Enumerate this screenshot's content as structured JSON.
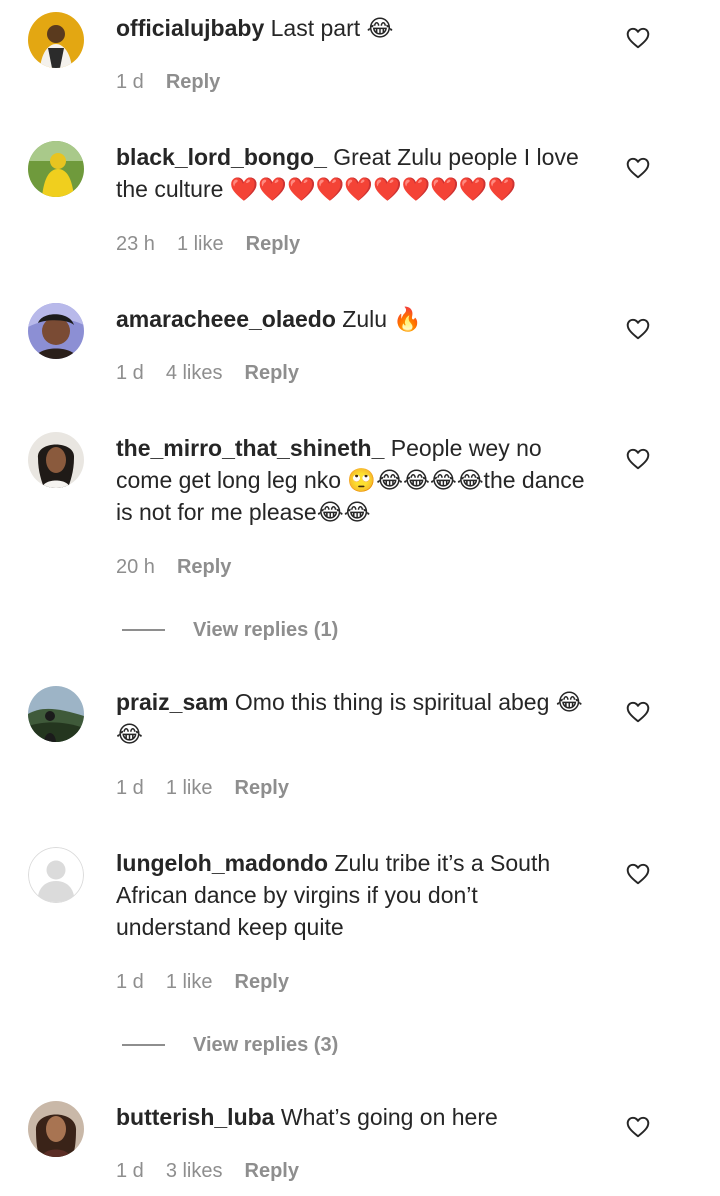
{
  "comments": [
    {
      "username": "officialujbaby",
      "text": "Last part 😂",
      "time": "1 d",
      "likes": "",
      "reply": "Reply"
    },
    {
      "username": "black_lord_bongo_",
      "text": "Great Zulu people I love the culture ❤️❤️❤️❤️❤️❤️❤️❤️❤️❤️",
      "time": "23 h",
      "likes": "1 like",
      "reply": "Reply"
    },
    {
      "username": "amaracheee_olaedo",
      "text": "Zulu 🔥",
      "time": "1 d",
      "likes": "4 likes",
      "reply": "Reply"
    },
    {
      "username": "the_mirro_that_shineth_",
      "text": "People wey no come get long leg nko 🙄😂😂😂😂the dance is not for me please😂😂",
      "time": "20 h",
      "likes": "",
      "reply": "Reply",
      "view_replies": "View replies (1)"
    },
    {
      "username": "praiz_sam",
      "text": "Omo this thing is spiritual abeg 😂😂",
      "time": "1 d",
      "likes": "1 like",
      "reply": "Reply"
    },
    {
      "username": "lungeloh_madondo",
      "text": "Zulu tribe it’s a South African dance by virgins if you don’t understand keep quite",
      "time": "1 d",
      "likes": "1 like",
      "reply": "Reply",
      "view_replies": "View replies (3)"
    },
    {
      "username": "butterish_luba",
      "text": "What’s going on here",
      "time": "1 d",
      "likes": "3 likes",
      "reply": "Reply"
    }
  ],
  "icons": {
    "like": "heart-outline-icon",
    "default_avatar": "person-silhouette-icon"
  },
  "colors": {
    "text": "#262626",
    "secondary": "#8e8e8e"
  }
}
